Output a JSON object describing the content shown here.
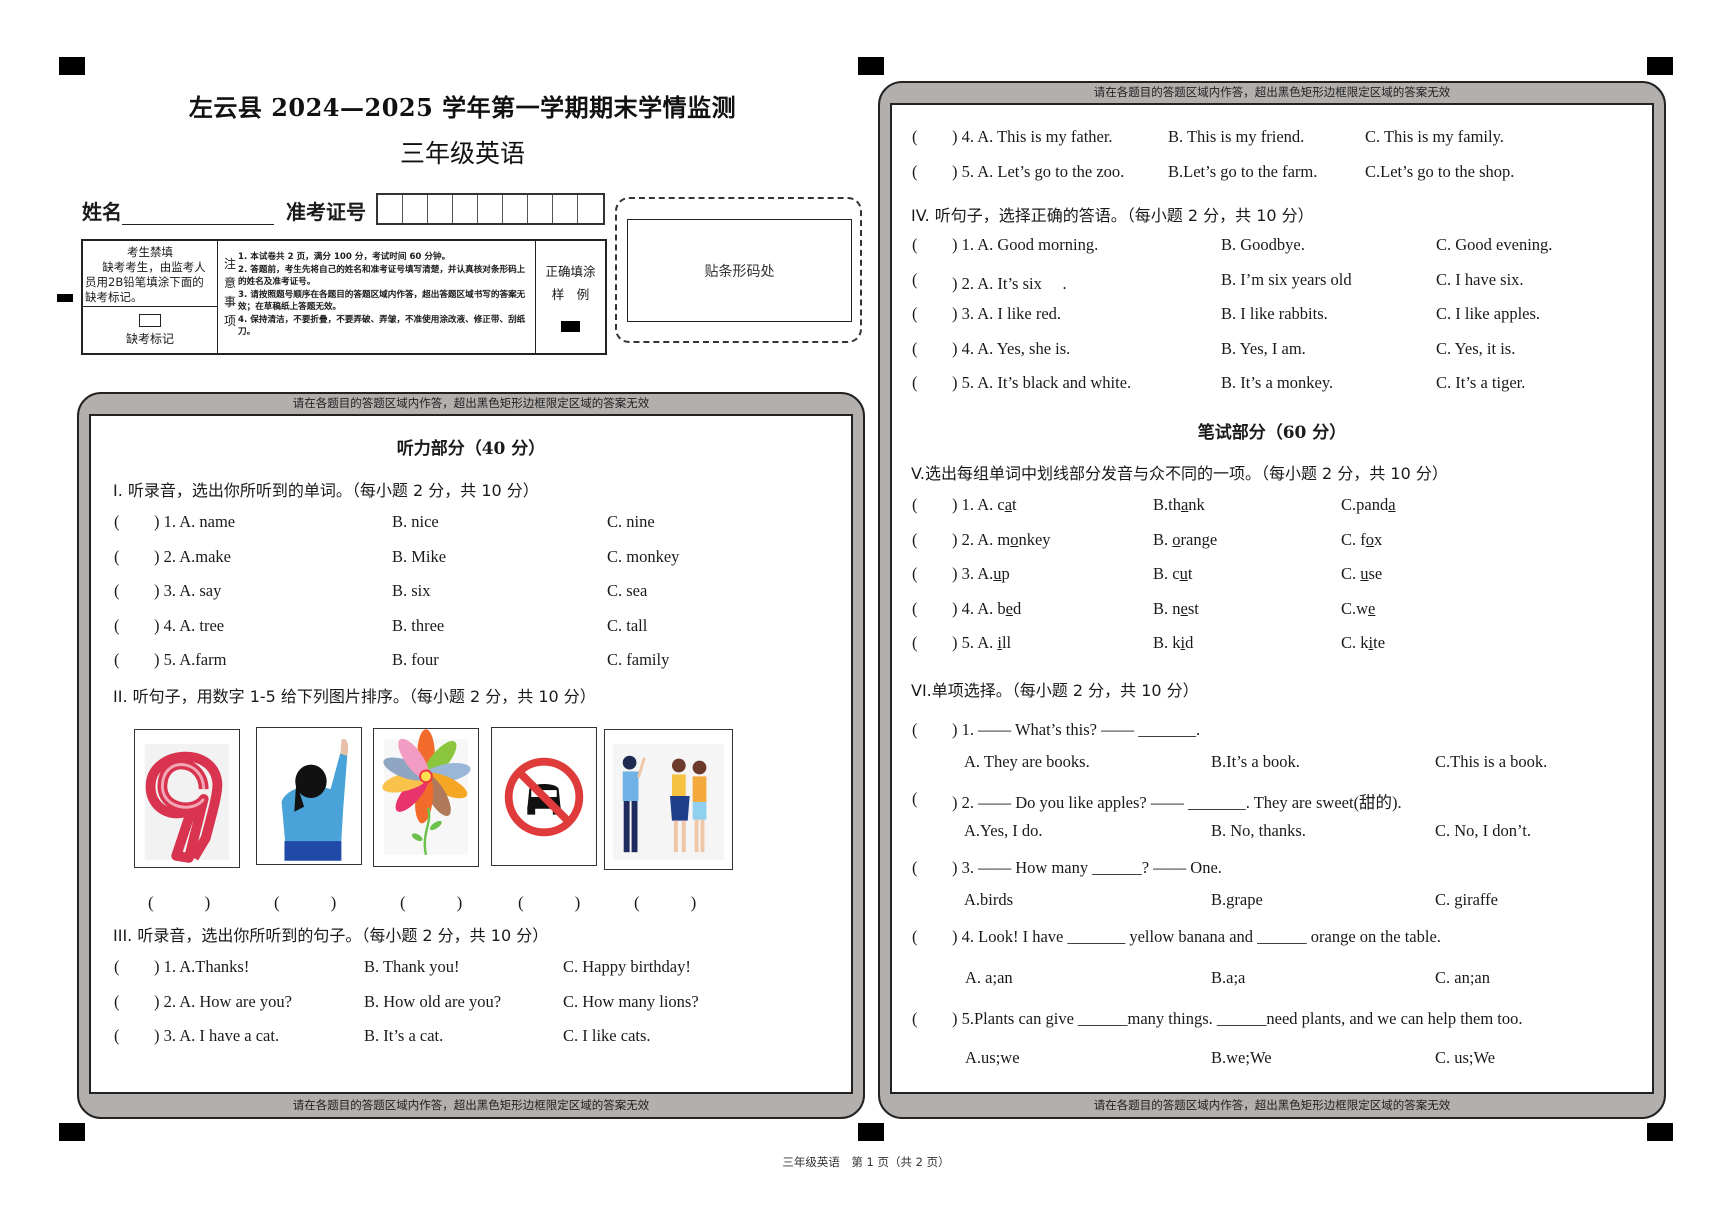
{
  "header": {
    "title": "左云县 2024—2025 学年第一学期期末学情监测",
    "subtitle": "三年级英语",
    "name_label": "姓名",
    "exam_id_label": "准考证号",
    "exam_id_boxes": 9,
    "barcode_label": "贴条形码处"
  },
  "notice_table": {
    "absent_title": "考生禁填",
    "absent_text": "缺考考生，由监考人员用2B铅笔填涂下面的缺考标记。",
    "absent_mark_label": "缺考标记",
    "notes_side_label": [
      "注",
      "意",
      "事",
      "项"
    ],
    "notes": [
      "1. 本试卷共 2 页，满分 100 分，考试时间 60 分钟。",
      "2. 答题前，考生先将自己的姓名和准考证号填写清楚，并认真核对条形码上的姓名及准考证号。",
      "3. 请按照题号顺序在各题目的答题区域内作答，超出答题区域书写的答案无效；在草稿纸上答题无效。",
      "4. 保持清洁，不要折叠，不要弄破、弄皱，不准使用涂改液、修正带、刮纸刀。"
    ],
    "sample_label_1": "正确填涂",
    "sample_label_2": "样　例"
  },
  "frame_notice": "请在各题目的答题区域内作答，超出黑色矩形边框限定区域的答案无效",
  "left": {
    "listening_title": "听力部分（40 分）",
    "section1": {
      "heading": "I. 听录音，选出你所听到的单词。（每小题 2 分，共 10 分）",
      "items": [
        {
          "num": ") 1. A. name",
          "b": "B. nice",
          "c": "C. nine"
        },
        {
          "num": ") 2. A.make",
          "b": "B. Mike",
          "c": "C. monkey"
        },
        {
          "num": ") 3. A. say",
          "b": "B. six",
          "c": "C. sea"
        },
        {
          "num": ") 4. A. tree",
          "b": "B. three",
          "c": "C. tall"
        },
        {
          "num": ") 5. A.farm",
          "b": "B. four",
          "c": "C. family"
        }
      ]
    },
    "section2": {
      "heading": "II. 听句子，用数字 1-5 给下列图片排序。（每小题 2 分，共 10 分）",
      "pictures": [
        "number-nine",
        "girl-waving",
        "flower",
        "no-cars-sign",
        "friends-greeting"
      ],
      "answer_blank": "(　　　)"
    },
    "section3": {
      "heading": "III. 听录音，选出你所听到的句子。（每小题 2 分，共 10 分）",
      "items": [
        {
          "num": ") 1. A.Thanks!",
          "b": "B. Thank you!",
          "c": "C. Happy birthday!"
        },
        {
          "num": ") 2. A. How are you?",
          "b": "B. How old are you?",
          "c": "C. How many lions?"
        },
        {
          "num": ") 3. A. I have a cat.",
          "b": "B. It’s a cat.",
          "c": "C. I like cats."
        }
      ]
    }
  },
  "right": {
    "section3_cont": [
      {
        "num": ") 4. A. This is my father.",
        "b": "B. This is my friend.",
        "c": "C. This is my family."
      },
      {
        "num": ") 5. A. Let’s go to the zoo.",
        "b": "B.Let’s go to the farm.",
        "c": "C.Let’s go to the shop."
      }
    ],
    "section4": {
      "heading": "IV. 听句子，选择正确的答语。（每小题 2 分，共 10 分）",
      "items": [
        {
          "num": ") 1. A. Good morning.",
          "b": "B. Goodbye.",
          "c": "C. Good evening."
        },
        {
          "num": ") 2. A. It’s six　 .",
          "b": "B. I’m six years old",
          "c": "C. I have six."
        },
        {
          "num": ") 3. A. I like red.",
          "b": "B. I like rabbits.",
          "c": "C. I like apples."
        },
        {
          "num": ") 4. A. Yes, she is.",
          "b": "B. Yes, I am.",
          "c": "C. Yes, it is."
        },
        {
          "num": ") 5. A. It’s black and white.",
          "b": "B. It’s a monkey.",
          "c": "C. It’s a tiger."
        }
      ]
    },
    "writing_title": "笔试部分（60 分）",
    "section5": {
      "heading": "V.选出每组单词中划线部分发音与众不同的一项。（每小题 2 分，共 10 分）",
      "items": [
        {
          "num": ") 1. A. ",
          "a": [
            "c",
            "a",
            "t"
          ],
          "b": [
            "B.th",
            "a",
            "nk"
          ],
          "c": [
            "C.pand",
            "a",
            ""
          ]
        },
        {
          "num": ") 2. A. ",
          "a": [
            "m",
            "o",
            "nkey"
          ],
          "b": [
            "B. ",
            "o",
            "range"
          ],
          "c": [
            "C. f",
            "o",
            "x"
          ]
        },
        {
          "num": ") 3. A.",
          "a": [
            "",
            "u",
            "p"
          ],
          "b": [
            "B. c",
            "u",
            "t"
          ],
          "c": [
            "C. ",
            "u",
            "se"
          ]
        },
        {
          "num": ") 4. A. ",
          "a": [
            "b",
            "e",
            "d"
          ],
          "b": [
            "B. n",
            "e",
            "st"
          ],
          "c": [
            "C.w",
            "e",
            ""
          ]
        },
        {
          "num": ") 5. A. ",
          "a": [
            "",
            "i",
            "ll"
          ],
          "b": [
            "B. k",
            "i",
            "d"
          ],
          "c": [
            "C. k",
            "i",
            "te"
          ]
        }
      ]
    },
    "section6": {
      "heading": "VI.单项选择。（每小题 2 分，共 10 分）",
      "items": [
        {
          "q": ") 1.  ——  What’s this?        ——  _______.",
          "a": "A. They are books.",
          "b": "B.It’s a book.",
          "c": "C.This is a book."
        },
        {
          "q": ") 2.  ——  Do you like apples?     ——  _______. They are sweet(甜的).",
          "a": "A.Yes, I do.",
          "b": "B. No, thanks.",
          "c": "C. No, I don’t."
        },
        {
          "q": ") 3.  ——  How many ______?     ——  One.",
          "a": "A.birds",
          "b": "B.grape",
          "c": "C. giraffe"
        },
        {
          "q": ") 4. Look! I have  _______  yellow banana and  ______  orange on the table.",
          "a": "A. a;an",
          "b": "B.a;a",
          "c": "C. an;an"
        },
        {
          "q": ") 5.Plants can give  ______many things.  ______need plants, and we can help them too.",
          "a": "A.us;we",
          "b": "B.we;We",
          "c": "C. us;We"
        }
      ]
    }
  },
  "footer": "三年级英语　第 1 页（共 2 页）",
  "open_paren": "("
}
